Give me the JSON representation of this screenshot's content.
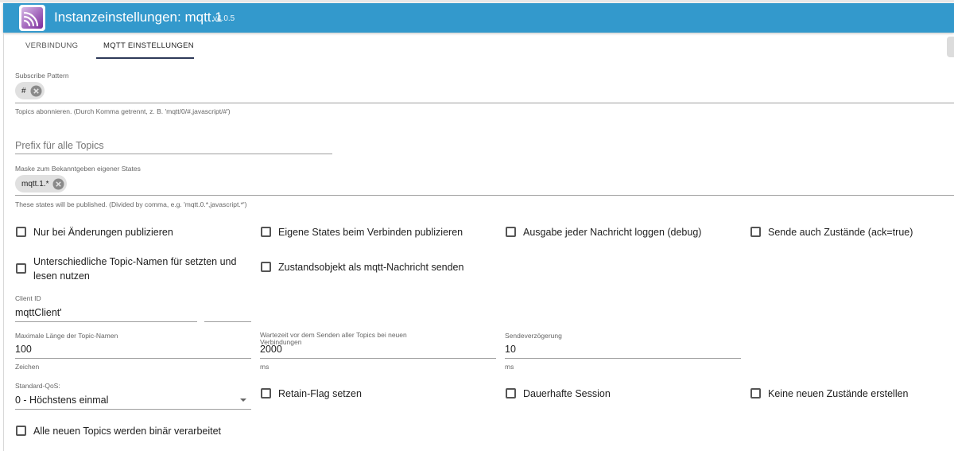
{
  "header": {
    "title": "Instanzeinstellungen: mqtt.1",
    "version": "v4.0.5",
    "logo_icon": "mqtt-logo-icon",
    "color": "#3399cc"
  },
  "tabs": [
    {
      "label": "VERBINDUNG",
      "active": false
    },
    {
      "label": "MQTT EINSTELLUNGEN",
      "active": true
    }
  ],
  "subscribe": {
    "label": "Subscribe Pattern",
    "chip": "#",
    "helper": "Topics abonnieren. (Durch Komma getrennt, z. B. 'mqtt/0/#,javascript/#')"
  },
  "prefix": {
    "placeholder": "Prefix für alle Topics"
  },
  "mask": {
    "label": "Maske zum Bekanntgeben eigener States",
    "chip": "mqtt.1.*",
    "helper": "These states will be published. (Divided by comma, e.g. 'mqtt.0.*,javascript.*')"
  },
  "checkboxes_row1": [
    {
      "label": "Nur bei Änderungen publizieren",
      "checked": false
    },
    {
      "label": "Eigene States beim Verbinden publizieren",
      "checked": false
    },
    {
      "label": "Ausgabe jeder Nachricht loggen (debug)",
      "checked": false
    },
    {
      "label": "Sende auch Zustände (ack=true)",
      "checked": false
    }
  ],
  "checkboxes_row2": [
    {
      "label": "Unterschiedliche Topic-Namen für setzten und lesen nutzen",
      "checked": false
    },
    {
      "label": "Zustandsobjekt als mqtt-Nachricht senden",
      "checked": false
    }
  ],
  "client_id": {
    "label": "Client ID",
    "value": "mqttClient'"
  },
  "max_length": {
    "label": "Maximale Länge der Topic-Namen",
    "value": "100",
    "helper": "Zeichen"
  },
  "wait_time": {
    "label": "Wartezeit vor dem Senden aller Topics bei neuen Verbindungen",
    "value": "2000",
    "helper": "ms"
  },
  "send_delay": {
    "label": "Sendeverzögerung",
    "value": "10",
    "helper": "ms"
  },
  "qos": {
    "label": "Standard-QoS:",
    "value": "0 - Höchstens einmal"
  },
  "checkboxes_row3": [
    {
      "label": "Retain-Flag setzen",
      "checked": false
    },
    {
      "label": "Dauerhafte Session",
      "checked": false
    },
    {
      "label": "Keine neuen Zustände erstellen",
      "checked": false
    }
  ],
  "checkbox_binary": {
    "label": "Alle neuen Topics werden binär verarbeitet",
    "checked": false
  }
}
